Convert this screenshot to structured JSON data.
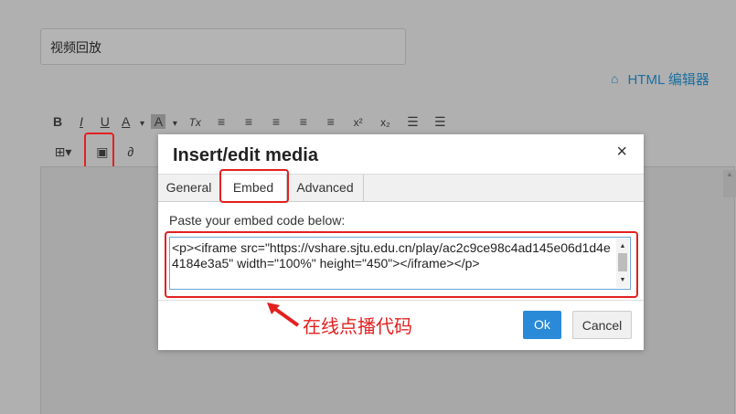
{
  "title_field": {
    "value": "视频回放"
  },
  "html_editor": {
    "icon": "html-editor-icon",
    "label": "HTML 编辑器"
  },
  "toolbar_row1": [
    {
      "name": "bold-button",
      "glyph": "B"
    },
    {
      "name": "italic-button",
      "glyph": "I"
    },
    {
      "name": "underline-button",
      "glyph": "U"
    },
    {
      "name": "font-color-button",
      "glyph": "A"
    },
    {
      "name": "font-color-dropdown",
      "glyph": "▾"
    },
    {
      "name": "background-color-button",
      "glyph": "A"
    },
    {
      "name": "background-color-dropdown",
      "glyph": "▾"
    },
    {
      "name": "clear-format-button",
      "glyph": "Tx"
    },
    {
      "name": "align-left-button",
      "glyph": "≡"
    },
    {
      "name": "align-center-button",
      "glyph": "≡"
    },
    {
      "name": "align-right-button",
      "glyph": "≡"
    },
    {
      "name": "indent-decrease-button",
      "glyph": "≡"
    },
    {
      "name": "indent-increase-button",
      "glyph": "≡"
    },
    {
      "name": "superscript-button",
      "glyph": "x²"
    },
    {
      "name": "subscript-button",
      "glyph": "x₂"
    },
    {
      "name": "bullet-list-button",
      "glyph": "☰"
    },
    {
      "name": "numbered-list-button",
      "glyph": "☰"
    }
  ],
  "toolbar_row2": [
    {
      "name": "table-button",
      "glyph": "⊞▾"
    },
    {
      "name": "media-button",
      "glyph": "▣"
    },
    {
      "name": "link-button",
      "glyph": "∂"
    }
  ],
  "dialog": {
    "title": "Insert/edit media",
    "close": "×",
    "tabs": [
      "General",
      "Embed",
      "Advanced"
    ],
    "active_tab": "Embed",
    "instruction": "Paste your embed code below:",
    "embed_code": "<p><iframe src=\"https://vshare.sjtu.edu.cn/play/ac2c9ce98c4ad145e06d1d4e4184e3a5\" width=\"100%\" height=\"450\"></iframe></p>",
    "ok_label": "Ok",
    "cancel_label": "Cancel"
  },
  "annotation": {
    "text": "在线点播代码",
    "color": "#e32020"
  },
  "colors": {
    "accent": "#2b8ad8",
    "highlight": "#e32020",
    "link": "#1c6fa0"
  }
}
